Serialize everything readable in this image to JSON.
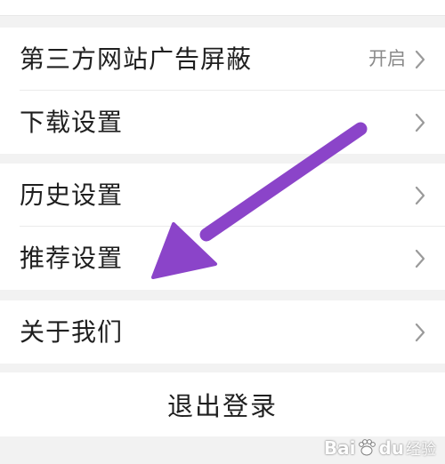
{
  "settings": {
    "group1": {
      "items": [
        {
          "label": "第三方网站广告屏蔽",
          "value": "开启"
        },
        {
          "label": "下载设置",
          "value": ""
        }
      ]
    },
    "group2": {
      "items": [
        {
          "label": "历史设置"
        },
        {
          "label": "推荐设置"
        }
      ]
    },
    "group3": {
      "items": [
        {
          "label": "关于我们"
        }
      ]
    }
  },
  "logout": {
    "label": "退出登录"
  },
  "watermark": {
    "brand": "Bai",
    "brand2": "du",
    "sub": "经验"
  },
  "annotation": {
    "arrow_color": "#8b44c9",
    "arrow_icon": "arrow-annotation"
  },
  "colors": {
    "background": "#f2f2f2",
    "card": "#ffffff",
    "text": "#1f1f1f",
    "muted": "#8a8a8a",
    "chevron": "#9a9a9a"
  }
}
